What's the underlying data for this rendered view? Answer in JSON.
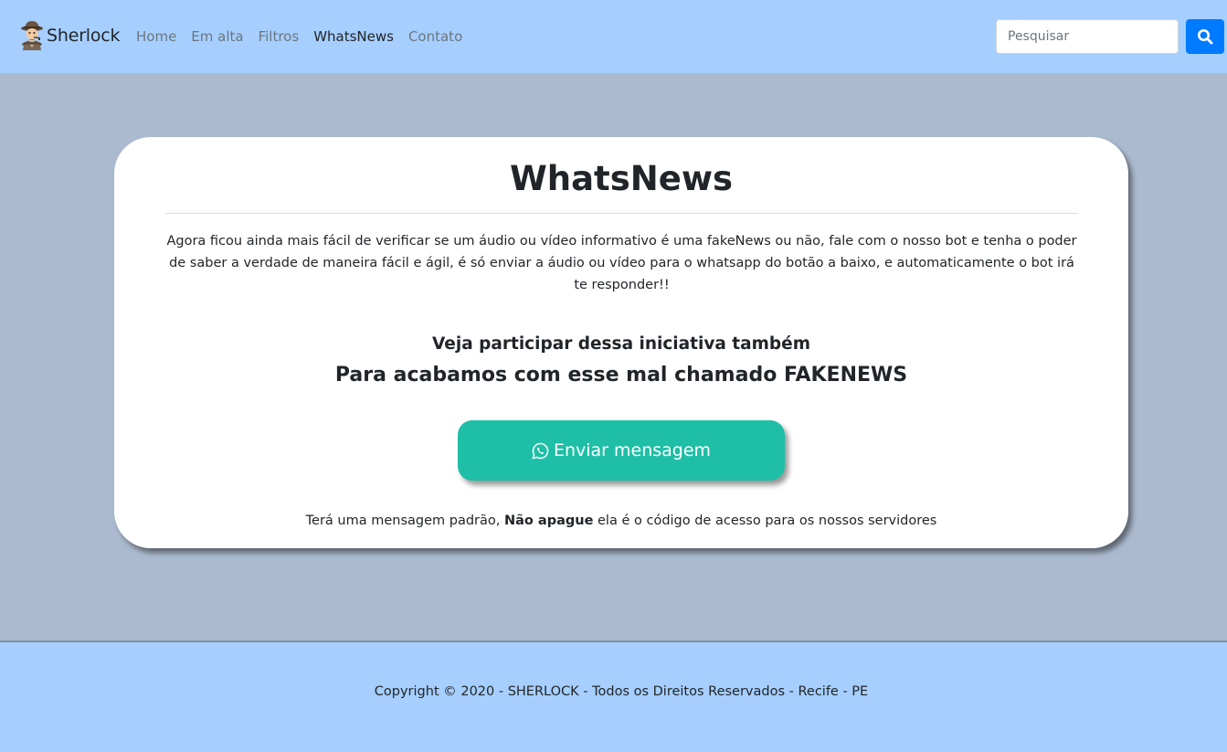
{
  "navbar": {
    "brand": "Sherlock",
    "logo_icon": "detective-icon",
    "nav_items": [
      {
        "label": "Home",
        "active": false
      },
      {
        "label": "Em alta",
        "active": false
      },
      {
        "label": "Filtros",
        "active": false
      },
      {
        "label": "WhatsNews",
        "active": true
      },
      {
        "label": "Contato",
        "active": false
      }
    ],
    "search": {
      "placeholder": "Pesquisar",
      "value": "",
      "button_icon": "search-icon"
    },
    "background_color": "#a6cfff"
  },
  "main": {
    "title": "WhatsNews",
    "description": "Agora ficou ainda mais fácil de verificar se um áudio ou vídeo informativo é uma fakeNews ou não, fale com o nosso bot e tenha o poder de saber a verdade de maneira fácil e ágil, é só enviar a áudio ou vídeo para o whatsapp do botão a baixo, e automaticamente o bot irá te responder!!",
    "subtitle_1": "Veja participar dessa iniciativa também",
    "subtitle_2": "Para acabamos com esse mal chamado FAKENEWS",
    "send_button": {
      "label": "Enviar mensagem",
      "icon": "whatsapp-icon",
      "color": "#1ebfa6"
    },
    "note": {
      "prefix": "Terá uma mensagem padrão,",
      "bold": "Não apague",
      "suffix": "ela é o código de acesso para os nossos servidores"
    },
    "background_color": "#abbacf"
  },
  "footer": {
    "text": "Copyright © 2020 - SHERLOCK - Todos os Direitos Reservados - Recife - PE"
  }
}
